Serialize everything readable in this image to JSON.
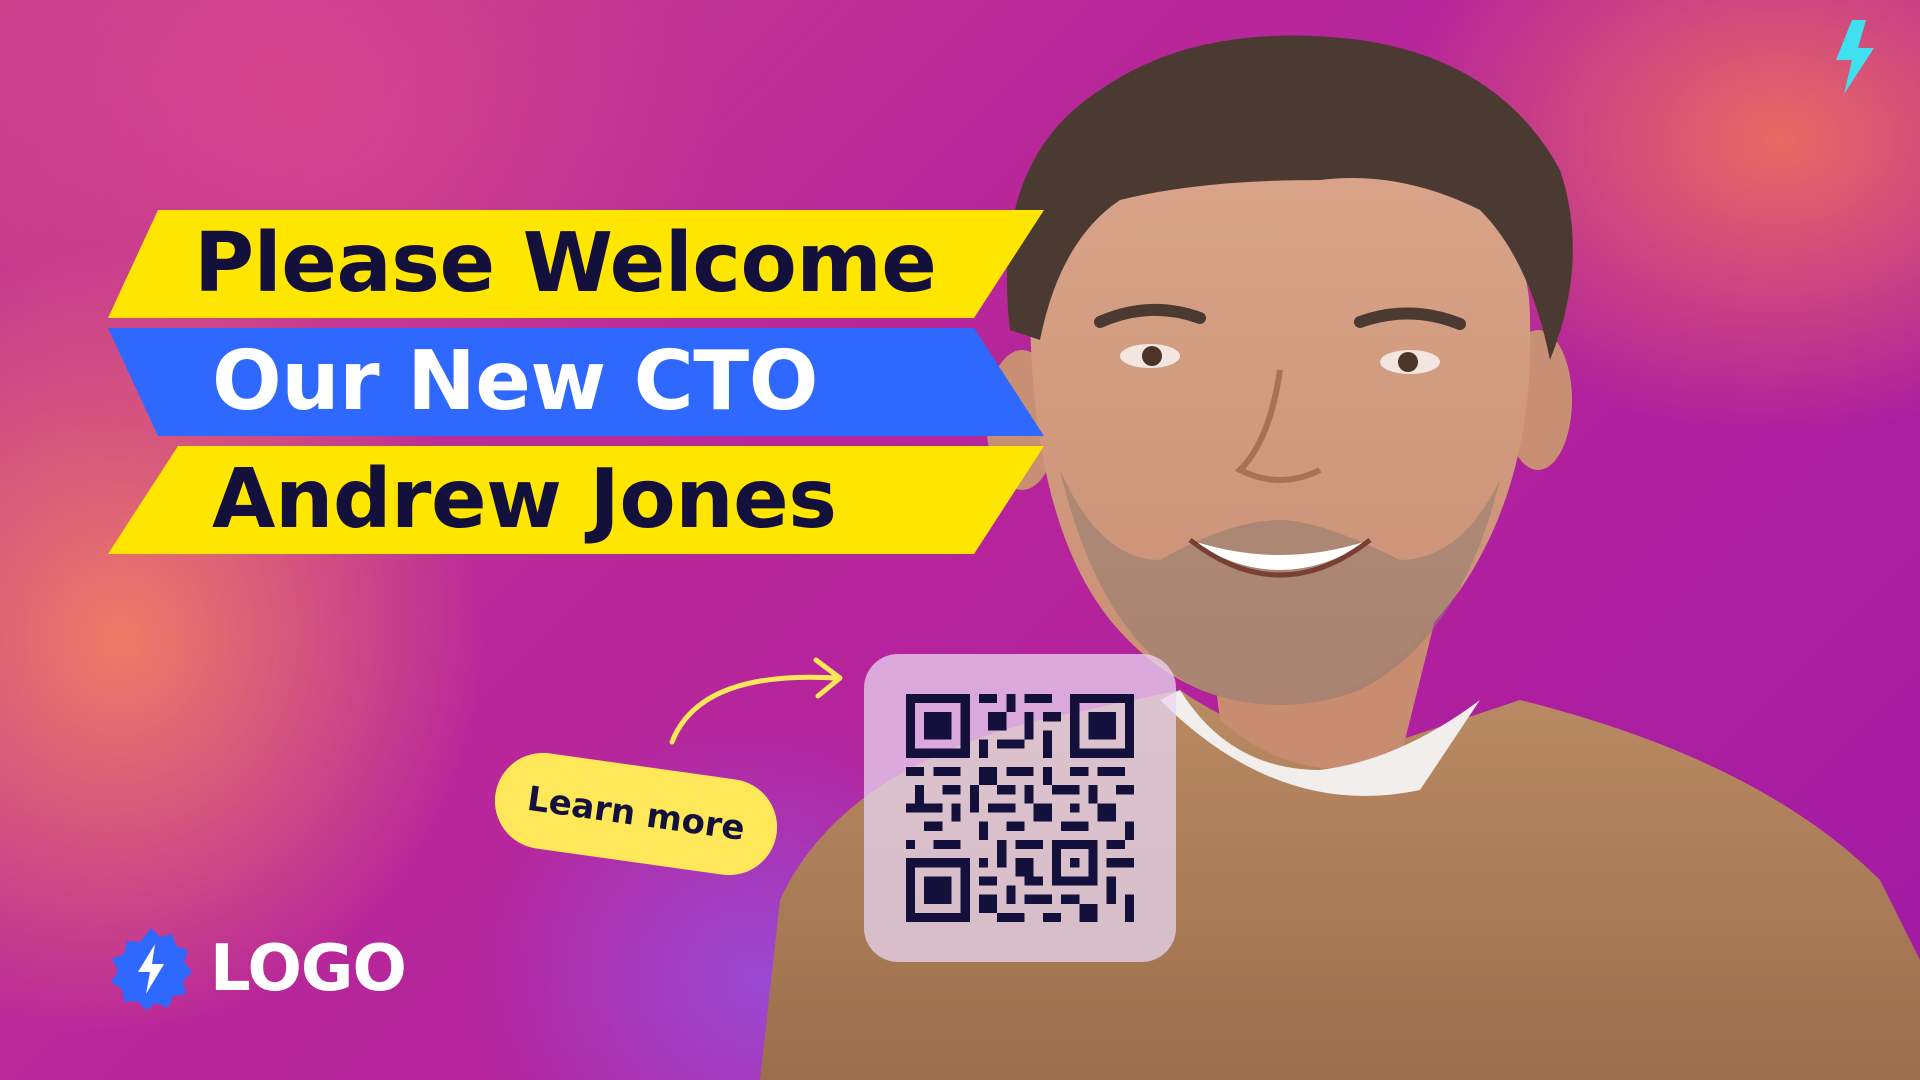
{
  "headline": {
    "line1": "Please Welcome",
    "line2": "Our New CTO",
    "line3": "Andrew Jones"
  },
  "cta": {
    "label": "Learn more"
  },
  "brand": {
    "logo_text": "LOGO"
  },
  "icons": {
    "corner": "lightning-bolt-icon",
    "logo_badge": "lightning-badge-icon",
    "qr": "qr-code",
    "arrow": "curved-arrow-icon"
  },
  "colors": {
    "yellow": "#ffe600",
    "blue": "#2f68ff",
    "navy": "#14103c",
    "teal_bolt": "#3fe0f0",
    "background_magenta": "#b0209e"
  }
}
